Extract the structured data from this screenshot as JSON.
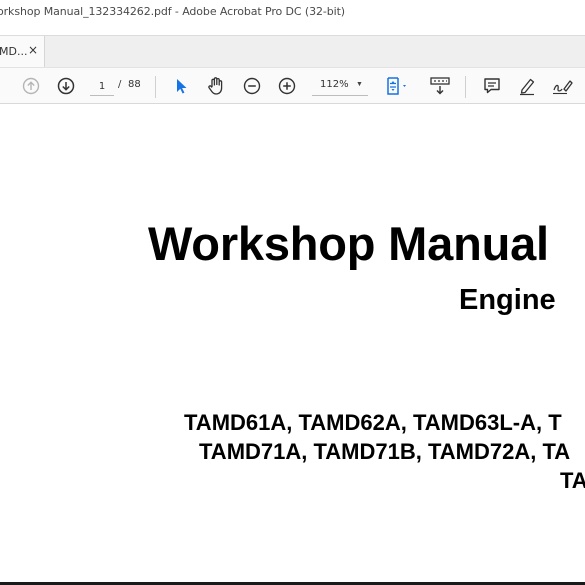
{
  "window": {
    "title": "orkshop Manual_132334262.pdf - Adobe Acrobat Pro DC (32-bit)"
  },
  "tabs": [
    {
      "label": "MD...",
      "close_label": "×"
    }
  ],
  "toolbar": {
    "current_page": "1",
    "page_separator": "/",
    "total_pages": "88",
    "zoom": "112%",
    "icons": [
      "page-up-icon",
      "page-down-icon",
      "select-tool-icon",
      "hand-tool-icon",
      "zoom-out-icon",
      "zoom-in-icon",
      "fit-page-icon",
      "scroll-mode-icon",
      "comment-icon",
      "highlight-icon",
      "sign-icon"
    ],
    "accent_color": "#1473e6"
  },
  "document": {
    "title": "Workshop Manual",
    "subtitle": "Engine",
    "model_lines": [
      "TAMD61A, TAMD62A, TAMD63L-A, T",
      "TAMD71A, TAMD71B, TAMD72A, TA",
      "TA"
    ]
  }
}
